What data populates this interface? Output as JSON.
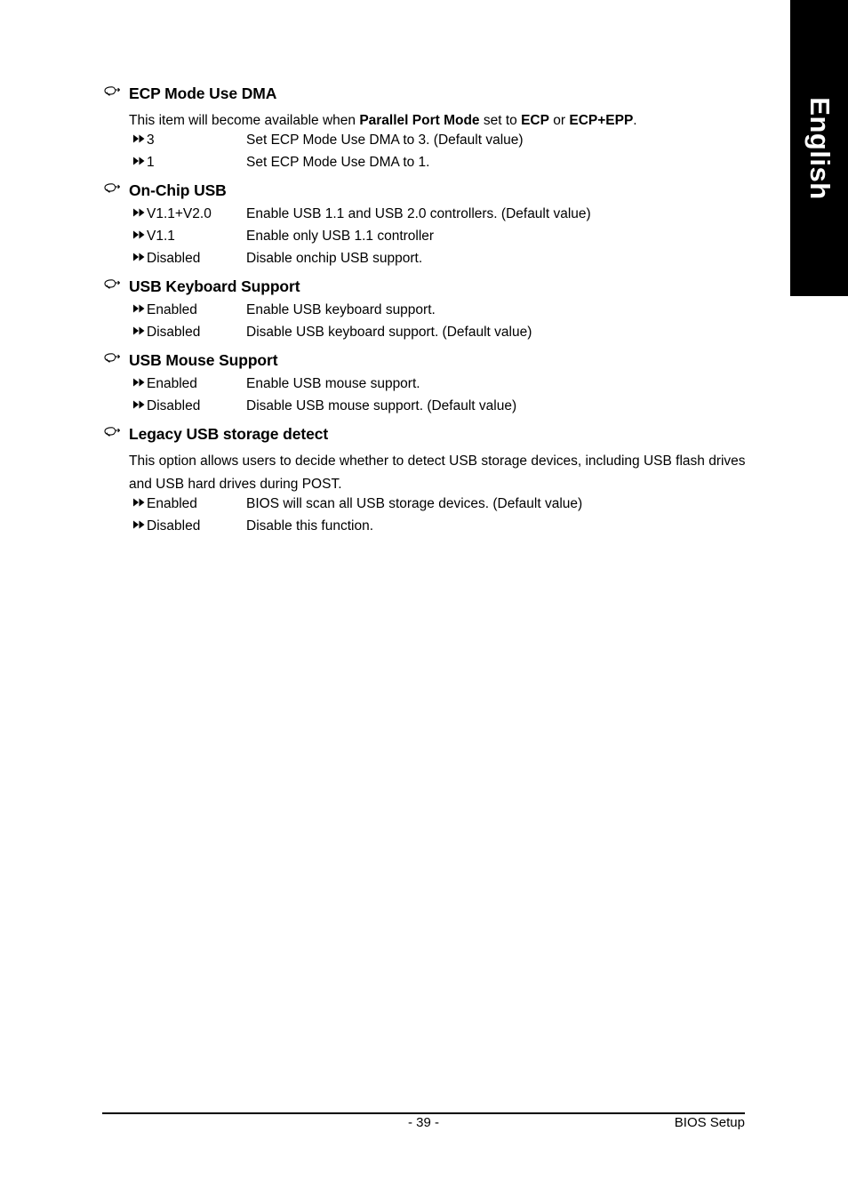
{
  "language_tab": {
    "label": "English"
  },
  "sections": [
    {
      "icon": "pointing-hand-icon",
      "title": "ECP Mode Use DMA",
      "description_parts": [
        {
          "text": "This item will become available when ",
          "bold": false
        },
        {
          "text": "Parallel Port Mode",
          "bold": true
        },
        {
          "text": " set to ",
          "bold": false
        },
        {
          "text": "ECP",
          "bold": true
        },
        {
          "text": " or ",
          "bold": false
        },
        {
          "text": "ECP+EPP",
          "bold": true
        },
        {
          "text": ".",
          "bold": false
        }
      ],
      "options": [
        {
          "value": "3",
          "desc": "Set ECP Mode Use DMA to 3. (Default value)"
        },
        {
          "value": "1",
          "desc": "Set ECP Mode Use DMA to 1."
        }
      ]
    },
    {
      "icon": "pointing-hand-icon",
      "title": "On-Chip USB",
      "description_parts": [],
      "options": [
        {
          "value": "V1.1+V2.0",
          "desc": "Enable USB 1.1 and USB 2.0 controllers. (Default value)"
        },
        {
          "value": "V1.1",
          "desc": "Enable only USB 1.1 controller"
        },
        {
          "value": "Disabled",
          "desc": "Disable onchip USB support."
        }
      ]
    },
    {
      "icon": "pointing-hand-icon",
      "title": "USB Keyboard Support",
      "description_parts": [],
      "options": [
        {
          "value": "Enabled",
          "desc": "Enable USB keyboard support."
        },
        {
          "value": "Disabled",
          "desc": "Disable USB keyboard support. (Default value)"
        }
      ]
    },
    {
      "icon": "pointing-hand-icon",
      "title": "USB Mouse Support",
      "description_parts": [],
      "options": [
        {
          "value": "Enabled",
          "desc": "Enable USB mouse support."
        },
        {
          "value": "Disabled",
          "desc": "Disable USB mouse support. (Default value)"
        }
      ]
    },
    {
      "icon": "pointing-hand-icon",
      "title": "Legacy USB storage detect",
      "description_parts": [
        {
          "text": "This option allows users to decide whether to detect USB storage devices, including USB flash drives and USB hard drives during POST.",
          "bold": false
        }
      ],
      "options": [
        {
          "value": "Enabled",
          "desc": "BIOS will scan all USB storage devices. (Default value)"
        },
        {
          "value": "Disabled",
          "desc": "Disable this function."
        }
      ]
    }
  ],
  "footer": {
    "page_number": "- 39 -",
    "document_label": "BIOS Setup"
  }
}
